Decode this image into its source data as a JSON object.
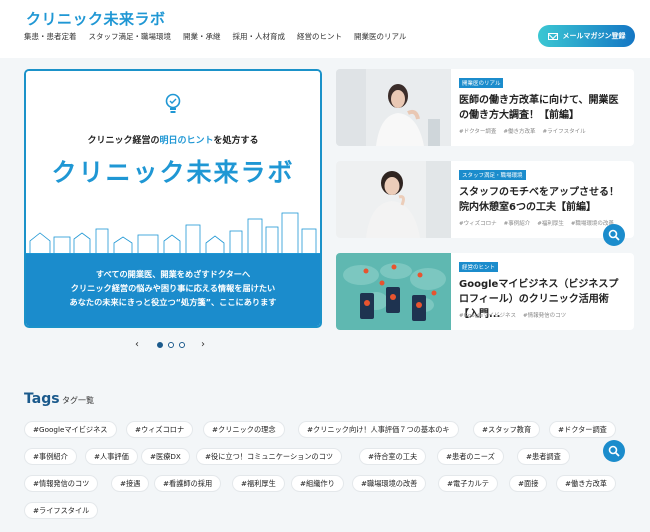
{
  "header": {
    "logo": "クリニック未来ラボ",
    "nav": [
      "集患・患者定着",
      "スタッフ満足・職場環境",
      "開業・承継",
      "採用・人材育成",
      "経営のヒント",
      "開業医のリアル"
    ],
    "mail_button": "メールマガジン登録"
  },
  "hero": {
    "tagline_pre": "クリニック経営の",
    "tagline_accent": "明日のヒント",
    "tagline_post": "を処方する",
    "brand": "クリニック未来ラボ",
    "lines": [
      "すべての開業医、開業をめざすドクターへ",
      "クリニック経営の悩みや困り事に応える情報を届けたい",
      "あなたの未来にきっと役立つ“処方箋”、ここにあります"
    ]
  },
  "pager": {
    "prev": "‹",
    "next": "›"
  },
  "articles": [
    {
      "badge": "開業医のリアル",
      "title": "医師の働き方改革に向けて、開業医の働き方大調査！【前編】",
      "tags": [
        "#ドクター調査",
        "#働き方改革",
        "#ライフスタイル"
      ]
    },
    {
      "badge": "スタッフ満足・職場環境",
      "title": "スタッフのモチベをアップさせる！院内休憩室6つの工夫【前編】",
      "tags": [
        "#ウィズコロナ",
        "#事例紹介",
        "#福利厚生",
        "#職場環境の改善"
      ]
    },
    {
      "badge": "経営のヒント",
      "title": "Googleマイビジネス（ビジネスプロフィール）のクリニック活用術【入門...",
      "tags": [
        "#Googleマイビジネス",
        "#情報発信のコツ"
      ]
    }
  ],
  "tags_section": {
    "heading": "Tags",
    "sub": "タグ一覧",
    "chips": [
      "#Googleマイビジネス",
      "#ウィズコロナ",
      "#クリニックの理念",
      "#クリニック向け！人事評価７つの基本のキ",
      "#スタッフ教育",
      "#ドクター調査",
      "#事例紹介",
      "#人事評価",
      "#医療DX",
      "#役に立つ！コミュニケーションのコツ",
      "#待合室の工夫",
      "#患者のニーズ",
      "#患者調査",
      "#情報発信のコツ",
      "#接遇",
      "#看護師の採用",
      "#福利厚生",
      "#組織作り",
      "#職場環境の改善",
      "#電子カルテ",
      "#面接",
      "#働き方改革",
      "#ライフスタイル"
    ]
  }
}
